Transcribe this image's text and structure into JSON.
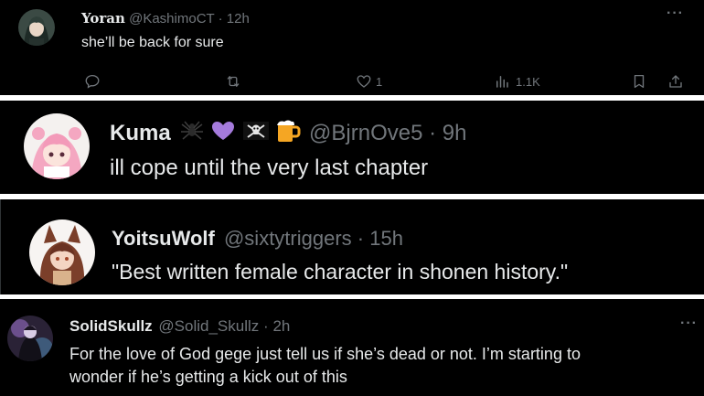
{
  "tweets": [
    {
      "display_name": "Yoran",
      "handle": "@KashimoCT",
      "separator": "·",
      "time": "12h",
      "text": "she’ll be back for sure",
      "more_icon": "more-horizontal-icon",
      "actions": {
        "reply_icon": "reply-icon",
        "retweet_icon": "retweet-icon",
        "like_icon": "heart-icon",
        "like_count": "1",
        "views_icon": "views-bar-chart-icon",
        "views_count": "1.1K",
        "bookmark_icon": "bookmark-icon",
        "share_icon": "share-icon"
      },
      "avatar_icon": "user-avatar-green-hair"
    },
    {
      "display_name": "Kuma",
      "name_emojis": [
        "spider-icon",
        "purple-heart-icon",
        "skull-crossbones-flag-icon",
        "beer-mug-icon"
      ],
      "handle": "@BjrnOve5",
      "separator": "·",
      "time": "9h",
      "text": "ill cope until the very last chapter",
      "avatar_icon": "user-avatar-pink-hair"
    },
    {
      "display_name": "YoitsuWolf",
      "handle": "@sixtytriggers",
      "separator": "·",
      "time": "15h",
      "text": "\"Best written female character in shonen history.\"",
      "avatar_icon": "user-avatar-wolf-girl"
    },
    {
      "display_name": "SolidSkullz",
      "handle": "@Solid_Skullz",
      "separator": "·",
      "time": "2h",
      "text_line1": "For the love of God gege just tell us if she’s dead or not. I’m starting to",
      "text_line2": "wonder if he’s getting a kick out of this",
      "more_icon": "more-horizontal-icon",
      "avatar_icon": "user-avatar-dark-figure"
    }
  ],
  "colors": {
    "background": "#000000",
    "separator": "#ffffff",
    "text_primary": "#e7e9ea",
    "text_secondary": "#71767b"
  }
}
